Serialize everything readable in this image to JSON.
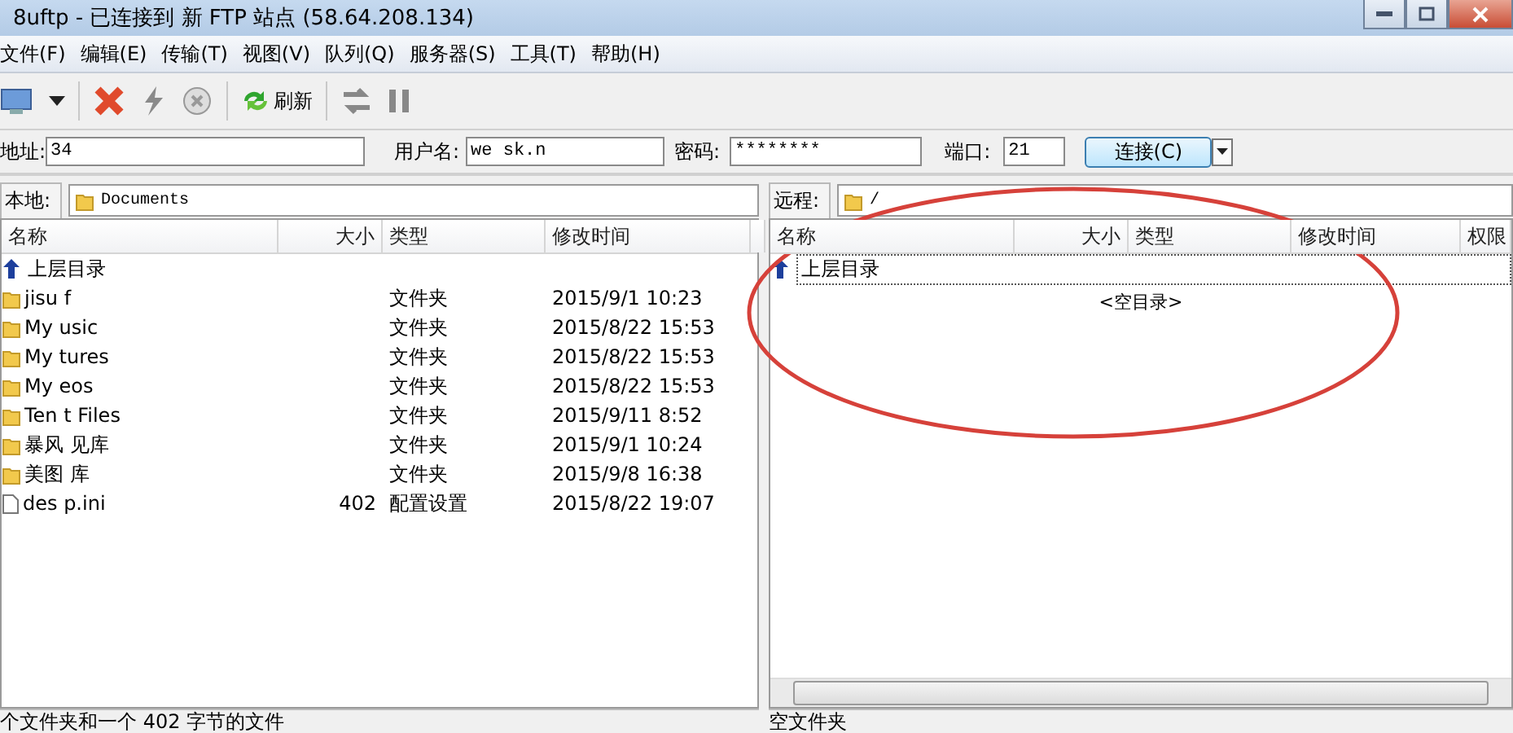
{
  "window": {
    "title": "8uftp - 已连接到 新 FTP 站点 (58.64.208.134)"
  },
  "menu": [
    "文件(F)",
    "编辑(E)",
    "传输(T)",
    "视图(V)",
    "队列(Q)",
    "服务器(S)",
    "工具(T)",
    "帮助(H)"
  ],
  "toolbar": {
    "refresh_label": "刷新"
  },
  "connection": {
    "address_label": "地址:",
    "address_value": "34",
    "user_label": "用户名:",
    "user_value": "we sk.n",
    "password_label": "密码:",
    "password_value": "********",
    "port_label": "端口:",
    "port_value": "21",
    "connect_button": "连接(C)"
  },
  "local": {
    "label": "本地:",
    "path": "Documents",
    "columns": [
      "名称",
      "大小",
      "类型",
      "修改时间"
    ],
    "rows": [
      {
        "kind": "up",
        "name": "上层目录",
        "size": "",
        "type": "",
        "modified": ""
      },
      {
        "kind": "folder",
        "name": "jisu f",
        "size": "",
        "type": "文件夹",
        "modified": "2015/9/1 10:23"
      },
      {
        "kind": "folder",
        "name": "My usic",
        "size": "",
        "type": "文件夹",
        "modified": "2015/8/22 15:53"
      },
      {
        "kind": "folder",
        "name": "My tures",
        "size": "",
        "type": "文件夹",
        "modified": "2015/8/22 15:53"
      },
      {
        "kind": "folder",
        "name": "My eos",
        "size": "",
        "type": "文件夹",
        "modified": "2015/8/22 15:53"
      },
      {
        "kind": "folder",
        "name": "Ten t Files",
        "size": "",
        "type": "文件夹",
        "modified": "2015/9/11 8:52"
      },
      {
        "kind": "folder",
        "name": "暴风 见库",
        "size": "",
        "type": "文件夹",
        "modified": "2015/9/1 10:24"
      },
      {
        "kind": "folder",
        "name": "美图 库",
        "size": "",
        "type": "文件夹",
        "modified": "2015/9/8 16:38"
      },
      {
        "kind": "file",
        "name": "des p.ini",
        "size": "402",
        "type": "配置设置",
        "modified": "2015/8/22 19:07"
      }
    ],
    "status": "个文件夹和一个 402 字节的文件"
  },
  "remote": {
    "label": "远程:",
    "path": "/",
    "columns": [
      "名称",
      "大小",
      "类型",
      "修改时间",
      "权限"
    ],
    "rows": [
      {
        "kind": "up",
        "name": "上层目录"
      }
    ],
    "empty_text": "<空目录>",
    "status": "空文件夹"
  }
}
